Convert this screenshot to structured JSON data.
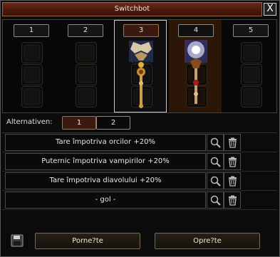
{
  "window": {
    "title": "Switchbot",
    "close_label": "X"
  },
  "slots": [
    {
      "label": "1"
    },
    {
      "label": "2"
    },
    {
      "label": "3"
    },
    {
      "label": "4"
    },
    {
      "label": "5"
    }
  ],
  "alternatives": {
    "label": "Alternativen:",
    "options": [
      "1",
      "2"
    ]
  },
  "bonuses": [
    {
      "text": "Tare împotriva orcilor +20%"
    },
    {
      "text": "Puternic împotriva vampirilor +20%"
    },
    {
      "text": "Tare împotriva diavolului +20%"
    },
    {
      "text": "- gol -"
    }
  ],
  "buttons": {
    "start": "Porne?te",
    "stop": "Opre?te"
  },
  "icons": {
    "close": "close-icon",
    "search": "search-icon",
    "delete": "trash-icon",
    "save": "floppy-disk-icon"
  }
}
